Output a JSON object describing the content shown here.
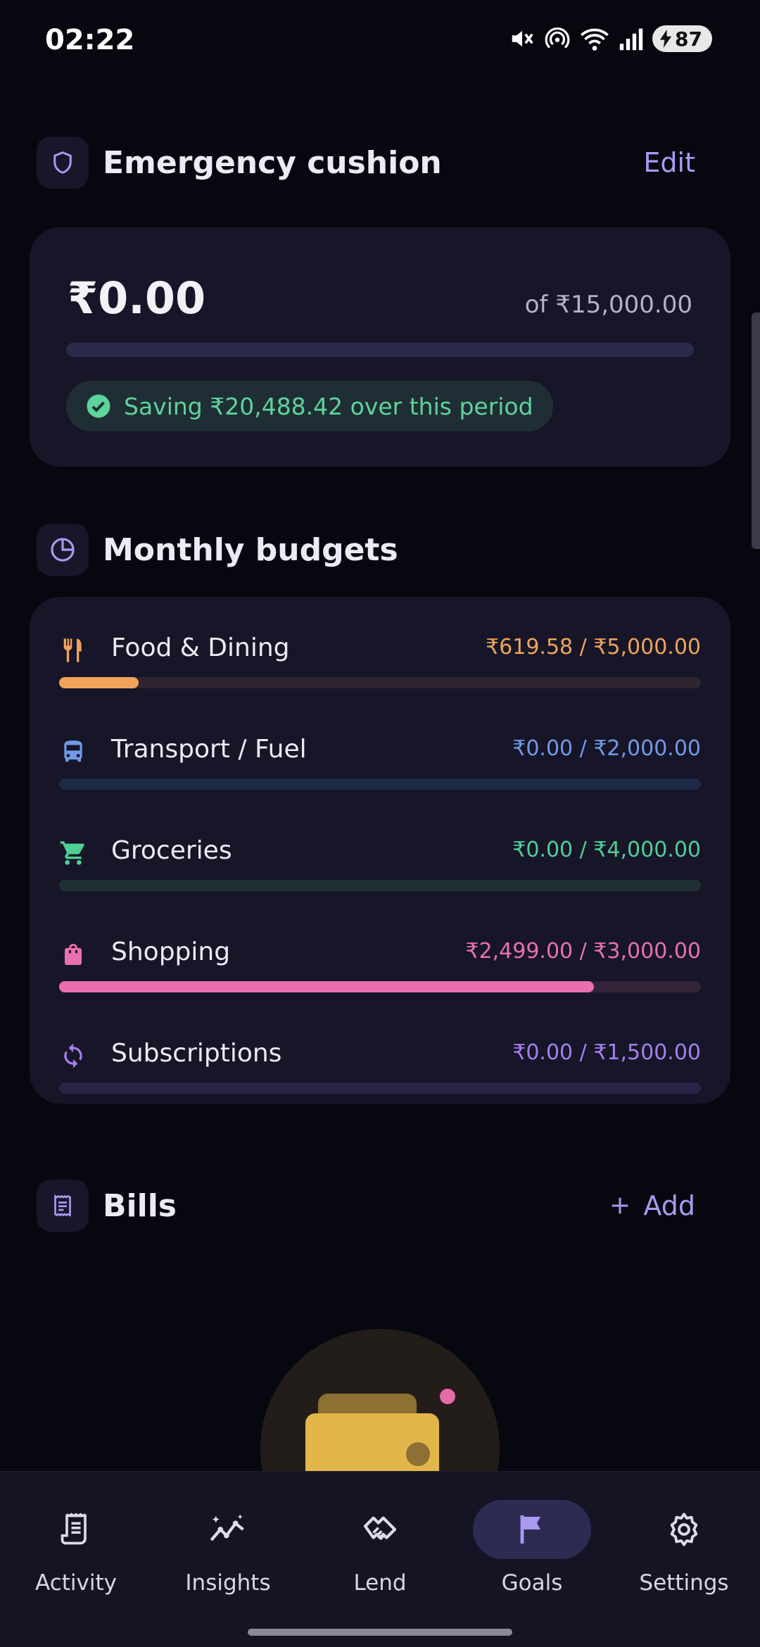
{
  "status": {
    "time": "02:22",
    "battery": "87"
  },
  "emergency": {
    "title": "Emergency cushion",
    "edit_label": "Edit",
    "amount": "₹0.00",
    "target": "of ₹15,000.00",
    "progress": 0,
    "saving_text": "Saving ₹20,488.42 over this period",
    "saving_color": "#5ed39c"
  },
  "budgets": {
    "title": "Monthly budgets",
    "items": [
      {
        "name": "Food & Dining",
        "amount": "₹619.58 / ₹5,000.00",
        "icon": "fork-knife-icon",
        "color": "#f0a35a",
        "track": "#2e2530",
        "progress": 0.1239
      },
      {
        "name": "Transport / Fuel",
        "amount": "₹0.00 / ₹2,000.00",
        "icon": "bus-icon",
        "color": "#6f9be8",
        "track": "#1f2a48",
        "progress": 0
      },
      {
        "name": "Groceries",
        "amount": "₹0.00 / ₹4,000.00",
        "icon": "cart-icon",
        "color": "#4fcf95",
        "track": "#1e3034",
        "progress": 0
      },
      {
        "name": "Shopping",
        "amount": "₹2,499.00 / ₹3,000.00",
        "icon": "shopping-bag-icon",
        "color": "#ea6fb0",
        "track": "#322338",
        "progress": 0.833
      },
      {
        "name": "Subscriptions",
        "amount": "₹0.00 / ₹1,500.00",
        "icon": "refresh-icon",
        "color": "#a67ff0",
        "track": "#2a2448",
        "progress": 0
      }
    ]
  },
  "bills": {
    "title": "Bills",
    "add_label": "Add"
  },
  "nav": {
    "items": [
      {
        "label": "Activity",
        "icon": "receipt-icon",
        "active": false
      },
      {
        "label": "Insights",
        "icon": "insights-icon",
        "active": false
      },
      {
        "label": "Lend",
        "icon": "handshake-icon",
        "active": false
      },
      {
        "label": "Goals",
        "icon": "flag-icon",
        "active": true
      },
      {
        "label": "Settings",
        "icon": "gear-icon",
        "active": false
      }
    ]
  },
  "colors": {
    "accent": "#a99af0",
    "background": "#07070f",
    "card": "#161628"
  }
}
